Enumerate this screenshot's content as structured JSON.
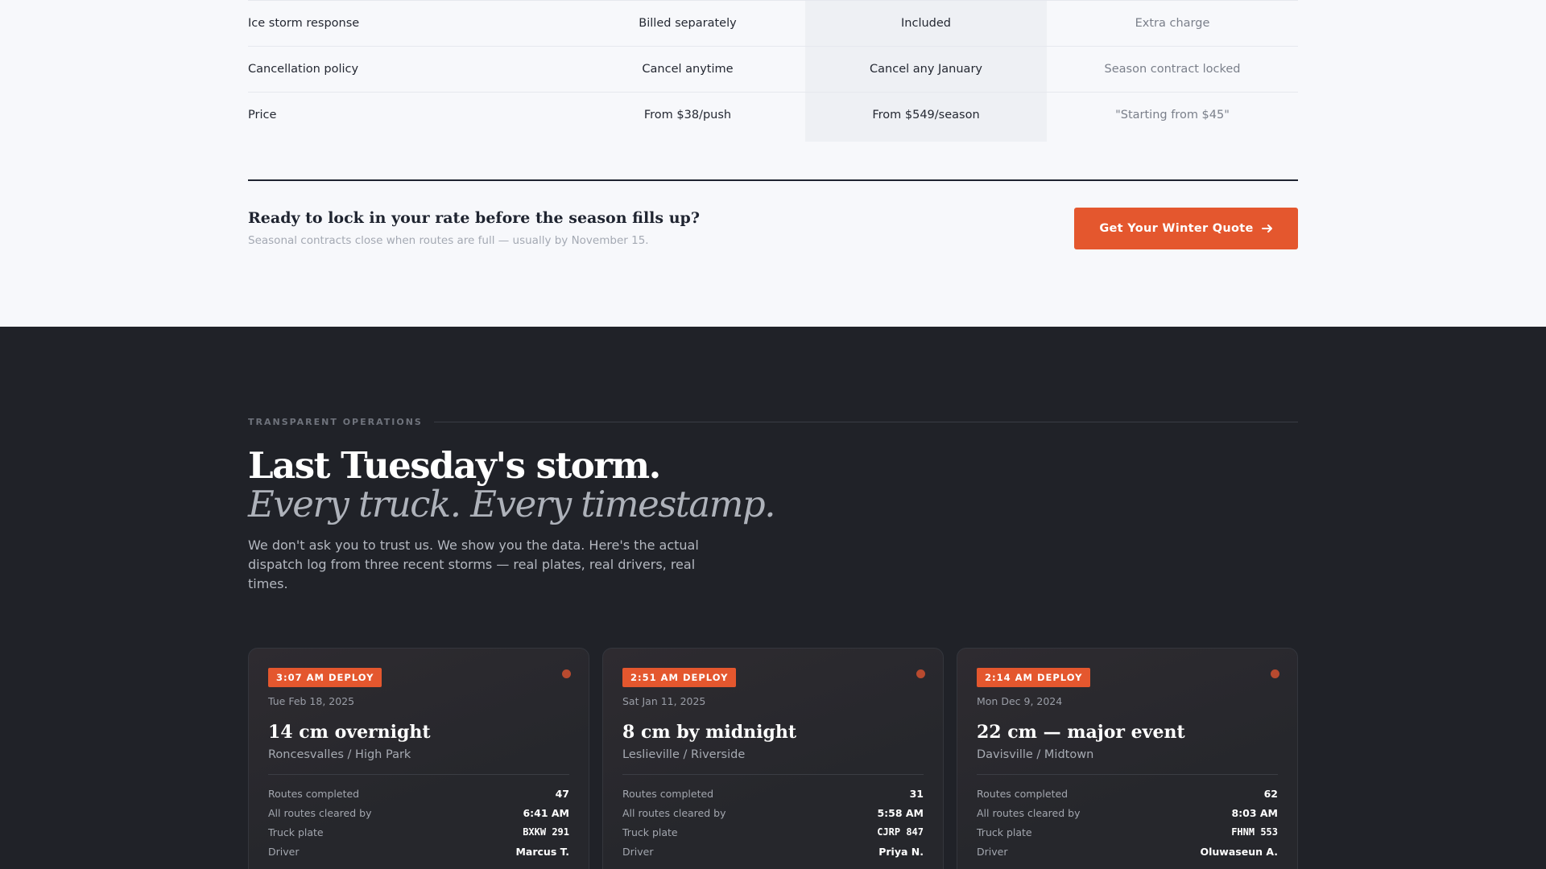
{
  "comparison": {
    "rows": [
      {
        "feature": "Ice storm response",
        "col1": "Billed separately",
        "col2": "Included",
        "col3": "Extra charge"
      },
      {
        "feature": "Cancellation policy",
        "col1": "Cancel anytime",
        "col2": "Cancel any January",
        "col3": "Season contract locked"
      },
      {
        "feature": "Price",
        "col1": "From $38/push",
        "col2": "From $549/season",
        "col3": "\"Starting from $45\""
      }
    ]
  },
  "cta": {
    "title": "Ready to lock in your rate before the season fills up?",
    "subtitle": "Seasonal contracts close when routes are full — usually by November 15.",
    "button_label": "Get Your Winter Quote",
    "button_icon": "arrow-right-icon"
  },
  "operations": {
    "eyebrow": "TRANSPARENT OPERATIONS",
    "headline": "Last Tuesday's storm.",
    "headline_italic": "Every truck. Every timestamp.",
    "lead": "We don't ask you to trust us. We show you the data. Here's the actual dispatch log from three recent storms — real plates, real drivers, real times.",
    "cards": [
      {
        "badge": "3:07 AM DEPLOY",
        "date": "Tue Feb 18, 2025",
        "title": "14 cm overnight",
        "area": "Roncesvalles / High Park",
        "stats": [
          {
            "label": "Routes completed",
            "value": "47"
          },
          {
            "label": "All routes cleared by",
            "value": "6:41 AM"
          },
          {
            "label": "Truck plate",
            "value": "BXKW 291"
          },
          {
            "label": "Driver",
            "value": "Marcus T."
          }
        ]
      },
      {
        "badge": "2:51 AM DEPLOY",
        "date": "Sat Jan 11, 2025",
        "title": "8 cm by midnight",
        "area": "Leslieville / Riverside",
        "stats": [
          {
            "label": "Routes completed",
            "value": "31"
          },
          {
            "label": "All routes cleared by",
            "value": "5:58 AM"
          },
          {
            "label": "Truck plate",
            "value": "CJRP 847"
          },
          {
            "label": "Driver",
            "value": "Priya N."
          }
        ]
      },
      {
        "badge": "2:14 AM DEPLOY",
        "date": "Mon Dec 9, 2024",
        "title": "22 cm — major event",
        "area": "Davisville / Midtown",
        "stats": [
          {
            "label": "Routes completed",
            "value": "62"
          },
          {
            "label": "All routes cleared by",
            "value": "8:03 AM"
          },
          {
            "label": "Truck plate",
            "value": "FHNM 553"
          },
          {
            "label": "Driver",
            "value": "Oluwaseun A."
          }
        ]
      }
    ]
  },
  "colors": {
    "accent": "#e4572e",
    "dark_bg": "#202228",
    "light_bg": "#f7f8fb"
  }
}
